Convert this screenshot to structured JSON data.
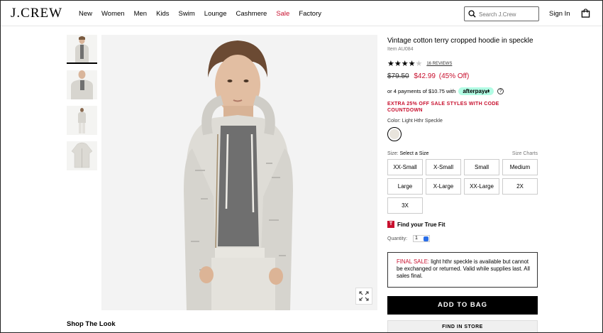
{
  "header": {
    "logo": "J.CREW",
    "nav": [
      "New",
      "Women",
      "Men",
      "Kids",
      "Swim",
      "Lounge",
      "Cashmere",
      "Sale",
      "Factory"
    ],
    "search_placeholder": "Search J.Crew",
    "sign_in": "Sign In"
  },
  "product": {
    "title": "Vintage cotton terry cropped hoodie in speckle",
    "item_number": "Item AU084",
    "rating": 4,
    "rating_max": 5,
    "reviews": "16 REVIEWS",
    "price_old": "$79.50",
    "price_new": "$42.99",
    "price_off": "(45% Off)",
    "afterpay_text": "or 4 payments of $10.75 with",
    "afterpay_brand": "afterpay",
    "promo": "EXTRA 25% OFF SALE STYLES WITH CODE COUNTDOWN",
    "color_label": "Color:",
    "color_value": "Light Hthr Speckle",
    "size_label": "Size:",
    "size_prompt": "Select a Size",
    "size_charts": "Size Charts",
    "sizes": [
      "XX-Small",
      "X-Small",
      "Small",
      "Medium",
      "Large",
      "X-Large",
      "XX-Large",
      "2X",
      "3X"
    ],
    "true_fit": "Find your True Fit",
    "true_fit_icon": "T",
    "quantity_label": "Quantity:",
    "quantity_value": "1",
    "final_sale_label": "FINAL SALE:",
    "final_sale_text": "light hthr speckle is available but cannot be exchanged or returned. Valid while supplies last. All sales final.",
    "add_to_bag": "ADD TO BAG",
    "find_in_store": "FIND IN STORE"
  },
  "shop_the_look": "Shop The Look",
  "colors": {
    "sale_red": "#c8102e",
    "afterpay_mint": "#b2fce4"
  }
}
